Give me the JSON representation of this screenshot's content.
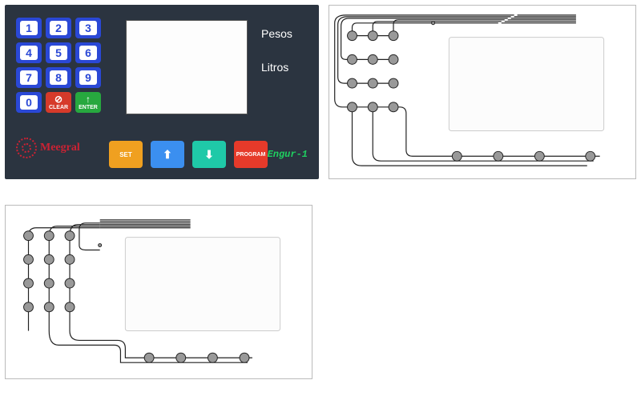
{
  "keypad": {
    "keys": [
      "1",
      "2",
      "3",
      "4",
      "5",
      "6",
      "7",
      "8",
      "9",
      "0"
    ],
    "clear_label": "CLEAR",
    "enter_label": "ENTER"
  },
  "display_labels": {
    "top": "Pesos",
    "bottom": "Litros"
  },
  "logo_text": "Meegral",
  "fn_buttons": {
    "set": "SET",
    "program": "PROGRAM"
  },
  "brand": "Engur-1"
}
